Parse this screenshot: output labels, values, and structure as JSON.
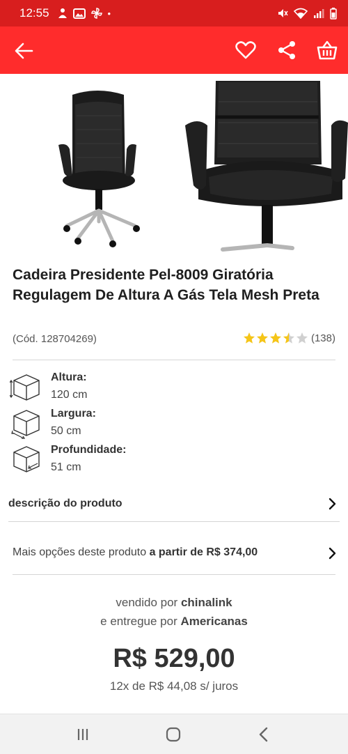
{
  "status_bar": {
    "time": "12:55",
    "dot": "•"
  },
  "app_bar": {
    "back_icon": "arrow-left-icon",
    "actions": [
      "heart-icon",
      "share-icon",
      "basket-icon"
    ]
  },
  "product": {
    "title": "Cadeira Presidente Pel-8009 Giratória Regulagem De Altura A Gás Tela Mesh Preta",
    "code": "(Cód. 128704269)",
    "rating_value": 3.5,
    "rating_count": "(138)"
  },
  "dimensions": [
    {
      "label": "Altura:",
      "value": "120 cm",
      "icon": "height-box-icon"
    },
    {
      "label": "Largura:",
      "value": "50 cm",
      "icon": "width-box-icon"
    },
    {
      "label": "Profundidade:",
      "value": "51 cm",
      "icon": "depth-box-icon"
    }
  ],
  "description_row": {
    "label": "descrição do produto"
  },
  "options_row": {
    "prefix": "Mais opções deste produto ",
    "highlight": "a partir de R$ 374,00"
  },
  "seller": {
    "sold_by_prefix": "vendido por ",
    "sold_by": "chinalink",
    "delivered_prefix": "e entregue por ",
    "delivered_by": "Americanas"
  },
  "price": {
    "value": "R$ 529,00",
    "installments": "12x de R$ 44,08 s/ juros"
  },
  "colors": {
    "brand_red": "#ff2c2c",
    "status_red": "#d81e1e",
    "star": "#f5c518",
    "star_empty": "#d0d0d0"
  }
}
